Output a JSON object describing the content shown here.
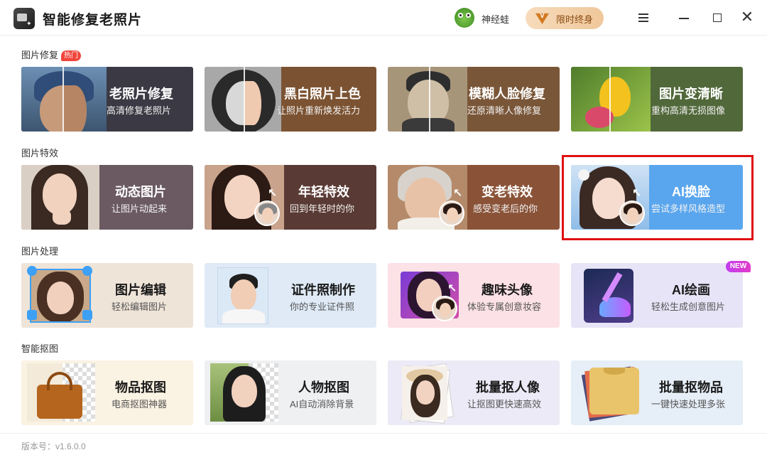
{
  "app": {
    "title": "智能修复老照片",
    "username": "神经蛙",
    "vip_label": "限时终身",
    "vip_icon": "V",
    "version": "版本号：v1.6.0.0"
  },
  "sections": {
    "repair": {
      "title": "图片修复",
      "badge": "热门"
    },
    "effects": {
      "title": "图片特效"
    },
    "process": {
      "title": "图片处理",
      "new_badge": "NEW"
    },
    "cutout": {
      "title": "智能抠图"
    }
  },
  "cards": {
    "old_photo": {
      "title": "老照片修复",
      "sub": "高清修复老照片"
    },
    "colorize": {
      "title": "黑白照片上色",
      "sub": "让照片重新焕发活力"
    },
    "blur_face": {
      "title": "模糊人脸修复",
      "sub": "还原清晰人像修复"
    },
    "sharpen": {
      "title": "图片变清晰",
      "sub": "重构高清无损图像"
    },
    "animate": {
      "title": "动态图片",
      "sub": "让图片动起来"
    },
    "younger": {
      "title": "年轻特效",
      "sub": "回到年轻时的你"
    },
    "older": {
      "title": "变老特效",
      "sub": "感受变老后的你"
    },
    "face_swap": {
      "title": "AI换脸",
      "sub": "尝试多样风格造型"
    },
    "edit": {
      "title": "图片编辑",
      "sub": "轻松编辑图片"
    },
    "id_photo": {
      "title": "证件照制作",
      "sub": "你的专业证件照"
    },
    "avatar": {
      "title": "趣味头像",
      "sub": "体验专属创意妆容"
    },
    "ai_paint": {
      "title": "AI绘画",
      "sub": "轻松生成创意图片"
    },
    "item_cut": {
      "title": "物品抠图",
      "sub": "电商抠图神器"
    },
    "person_cut": {
      "title": "人物抠图",
      "sub": "AI自动消除背景"
    },
    "batch_person": {
      "title": "批量抠人像",
      "sub": "让抠图更快速高效"
    },
    "batch_item": {
      "title": "批量抠物品",
      "sub": "一键快速处理多张"
    }
  },
  "colors": {
    "accent_red": "#e01010",
    "hot_badge": "#f0463c",
    "vip_text": "#8a4b12"
  },
  "icons": [
    "app-logo-icon",
    "frog-avatar-icon",
    "vip-crown-icon",
    "menu-icon",
    "minimize-icon",
    "maximize-icon",
    "close-icon"
  ]
}
